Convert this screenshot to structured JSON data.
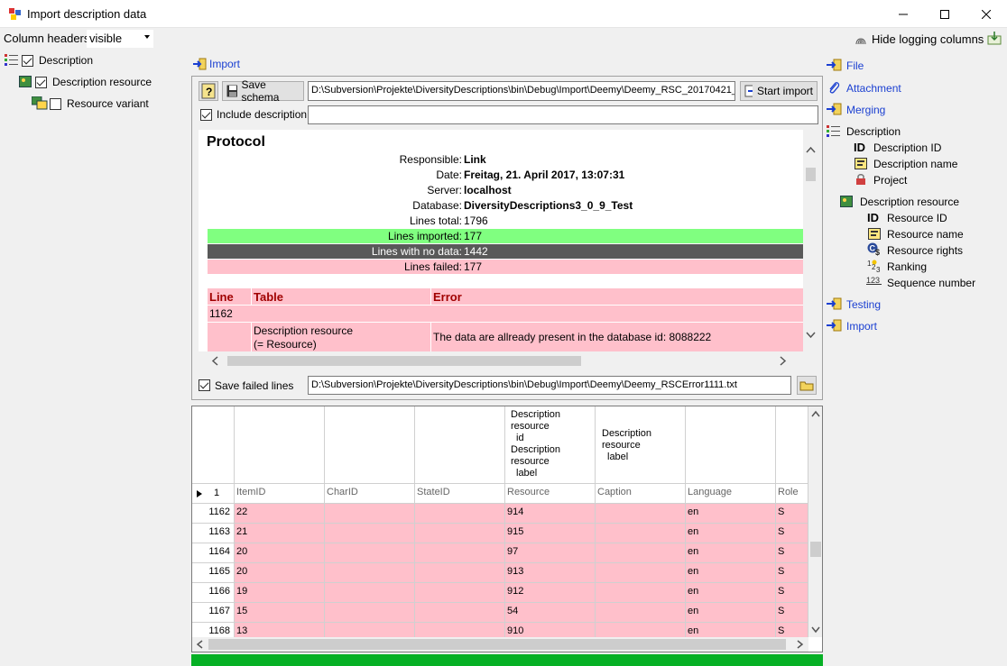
{
  "window": {
    "title": "Import description data"
  },
  "toolbar": {
    "column_headers_label": "Column headers",
    "column_headers_value": "visible",
    "hide_logging_label": "Hide logging columns"
  },
  "tree": {
    "description": "Description",
    "description_resource": "Description resource",
    "resource_variant": "Resource variant"
  },
  "import_link": "Import",
  "schema": {
    "save_schema_label": "Save schema",
    "schema_path": "D:\\Subversion\\Projekte\\DiversityDescriptions\\bin\\Debug\\Import\\Deemy\\Deemy_RSC_20170421_",
    "start_import_label": "Start import",
    "include_description_label": "Include description:",
    "include_description_value": ""
  },
  "protocol": {
    "title": "Protocol",
    "responsible_label": "Responsible:",
    "responsible": "Link",
    "date_label": "Date:",
    "date": "Freitag, 21. April 2017, 13:07:31",
    "server_label": "Server:",
    "server": "localhost",
    "database_label": "Database:",
    "database": "DiversityDescriptions3_0_9_Test",
    "lines_total_label": "Lines total:",
    "lines_total": "1796",
    "lines_imported_label": "Lines imported:",
    "lines_imported": "177",
    "lines_nodata_label": "Lines with no data:",
    "lines_nodata": "1442",
    "lines_failed_label": "Lines failed:",
    "lines_failed": "177",
    "table_headers": [
      "Line",
      "Table",
      "Error"
    ],
    "error_line": "1162",
    "error_table_1": "Description resource",
    "error_table_2": "(= Resource)",
    "error_message": "The data are allready present in the database id: 8088222",
    "colors": {
      "imported": "#80ff80",
      "nodata": "#595959",
      "failed": "#ffc0cb",
      "header": "#a00000"
    }
  },
  "failed": {
    "save_failed_label": "Save failed lines",
    "failed_path": "D:\\Subversion\\Projekte\\DiversityDescriptions\\bin\\Debug\\Import\\Deemy\\Deemy_RSCError1111.txt"
  },
  "grid": {
    "mapping_header_1": [
      "Description",
      "resource",
      "id",
      "Description",
      "resource",
      "label"
    ],
    "mapping_header_2": [
      "Description",
      "resource",
      "label"
    ],
    "first_row_number": "1",
    "columns": [
      "ItemID",
      "CharID",
      "StateID",
      "Resource",
      "Caption",
      "Language",
      "Role"
    ],
    "rows": [
      {
        "num": "1162",
        "cells": [
          "22",
          "",
          "",
          "914",
          "",
          "en",
          "S"
        ]
      },
      {
        "num": "1163",
        "cells": [
          "21",
          "",
          "",
          "915",
          "",
          "en",
          "S"
        ]
      },
      {
        "num": "1164",
        "cells": [
          "20",
          "",
          "",
          "97",
          "",
          "en",
          "S"
        ]
      },
      {
        "num": "1165",
        "cells": [
          "20",
          "",
          "",
          "913",
          "",
          "en",
          "S"
        ]
      },
      {
        "num": "1166",
        "cells": [
          "19",
          "",
          "",
          "912",
          "",
          "en",
          "S"
        ]
      },
      {
        "num": "1167",
        "cells": [
          "15",
          "",
          "",
          "54",
          "",
          "en",
          "S"
        ]
      },
      {
        "num": "1168",
        "cells": [
          "13",
          "",
          "",
          "910",
          "",
          "en",
          "S"
        ]
      }
    ]
  },
  "right_panel": {
    "file": "File",
    "attachment": "Attachment",
    "merging": "Merging",
    "description": "Description",
    "description_id": "Description ID",
    "description_name": "Description name",
    "project": "Project",
    "description_resource": "Description resource",
    "resource_id": "Resource ID",
    "resource_name": "Resource name",
    "resource_rights": "Resource rights",
    "ranking": "Ranking",
    "sequence_number": "Sequence number",
    "testing": "Testing",
    "import": "Import"
  },
  "progress": {
    "fraction": 1.0,
    "color": "#06b025"
  }
}
